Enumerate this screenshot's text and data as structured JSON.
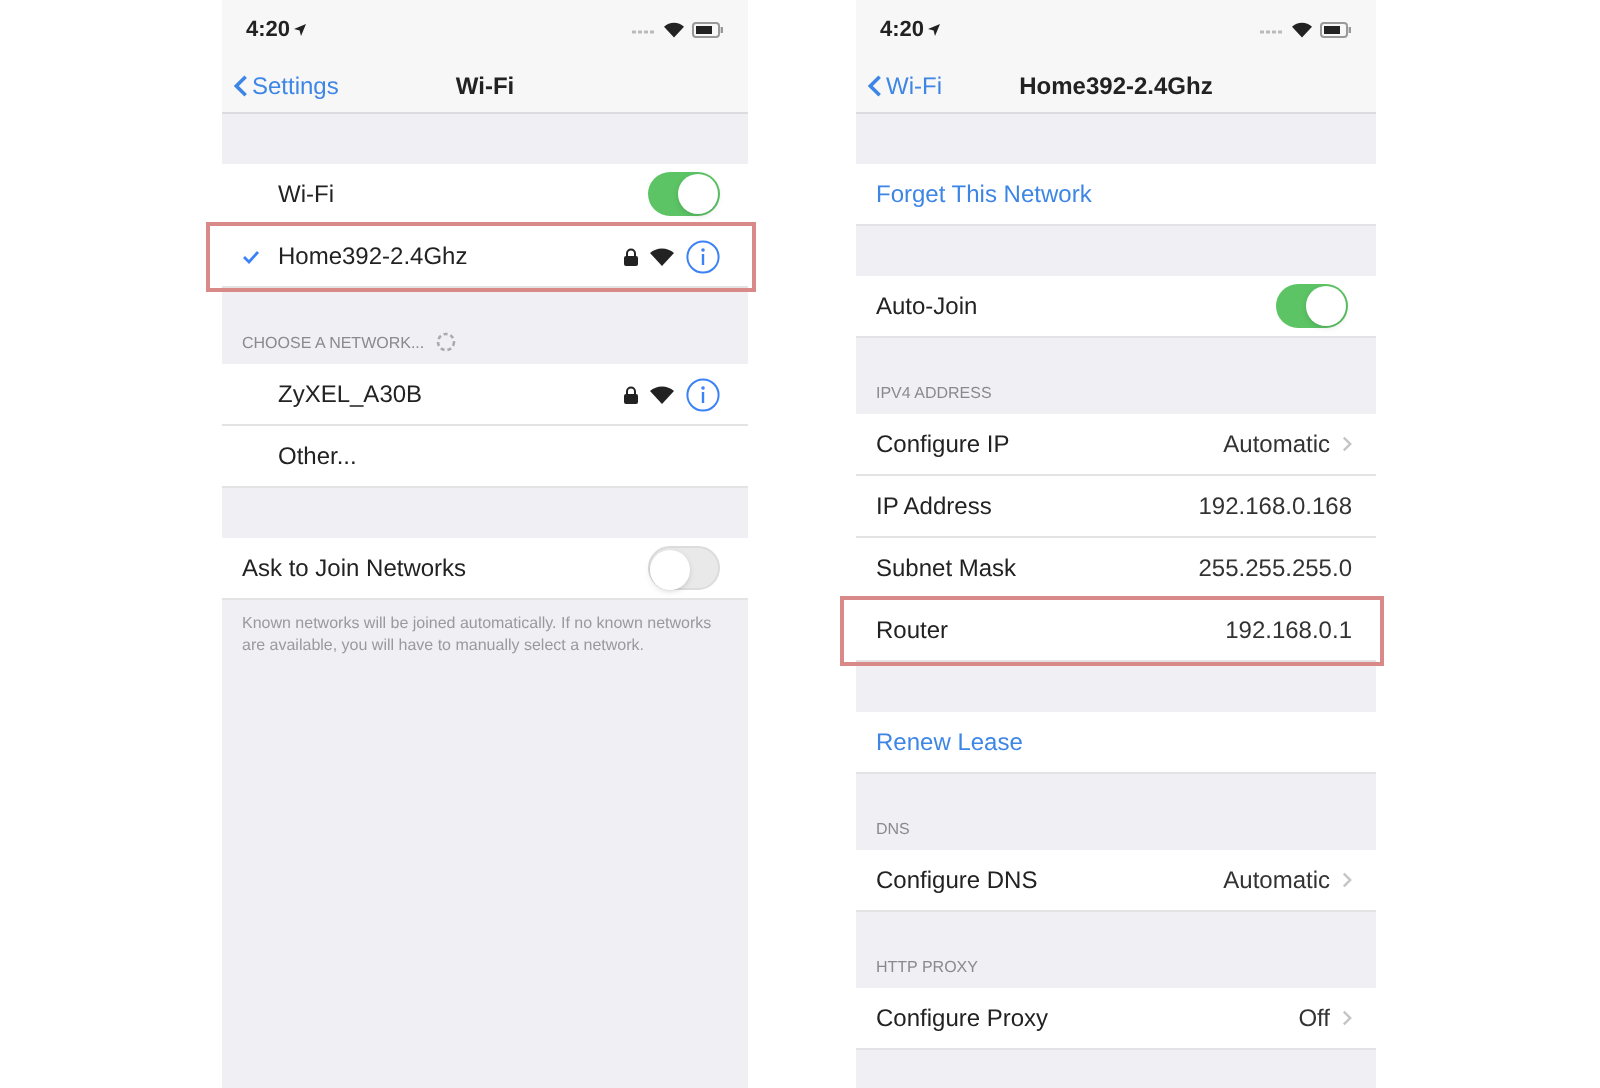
{
  "screens": [
    {
      "status": {
        "time": "4:20"
      },
      "nav": {
        "back": "Settings",
        "title": "Wi-Fi"
      },
      "items": [
        {
          "kind": "gap"
        },
        {
          "kind": "toggle",
          "label": "Wi-Fi",
          "on": true,
          "highlighted": false,
          "indent": true
        },
        {
          "kind": "network",
          "label": "Home392-2.4Ghz",
          "checked": true,
          "highlighted": true
        },
        {
          "kind": "header",
          "label": "CHOOSE A NETWORK...",
          "spinner": true
        },
        {
          "kind": "network",
          "label": "ZyXEL_A30B",
          "checked": false,
          "highlighted": false
        },
        {
          "kind": "other",
          "label": "Other...",
          "highlighted": false
        },
        {
          "kind": "gap"
        },
        {
          "kind": "toggle",
          "label": "Ask to Join Networks",
          "on": false,
          "highlighted": false,
          "indent": false
        },
        {
          "kind": "footer",
          "label": "Known networks will be joined automatically. If no known networks are available, you will have to manually select a network."
        }
      ]
    },
    {
      "status": {
        "time": "4:20"
      },
      "nav": {
        "back": "Wi-Fi",
        "title": "Home392-2.4Ghz"
      },
      "items": [
        {
          "kind": "gap"
        },
        {
          "kind": "link",
          "label": "Forget This Network",
          "highlighted": false
        },
        {
          "kind": "gap"
        },
        {
          "kind": "toggle",
          "label": "Auto-Join",
          "on": true,
          "highlighted": false,
          "indent": false
        },
        {
          "kind": "header",
          "label": "IPV4 ADDRESS",
          "spinner": false
        },
        {
          "kind": "value",
          "label": "Configure IP",
          "value": "Automatic",
          "disclosure": true,
          "highlighted": false
        },
        {
          "kind": "value",
          "label": "IP Address",
          "value": "192.168.0.168",
          "disclosure": false,
          "highlighted": false
        },
        {
          "kind": "value",
          "label": "Subnet Mask",
          "value": "255.255.255.0",
          "disclosure": false,
          "highlighted": false
        },
        {
          "kind": "value",
          "label": "Router",
          "value": "192.168.0.1",
          "disclosure": false,
          "highlighted": true
        },
        {
          "kind": "gap"
        },
        {
          "kind": "link",
          "label": "Renew Lease",
          "highlighted": false
        },
        {
          "kind": "header",
          "label": "DNS",
          "spinner": false
        },
        {
          "kind": "value",
          "label": "Configure DNS",
          "value": "Automatic",
          "disclosure": true,
          "highlighted": false
        },
        {
          "kind": "header",
          "label": "HTTP PROXY",
          "spinner": false
        },
        {
          "kind": "value",
          "label": "Configure Proxy",
          "value": "Off",
          "disclosure": true,
          "highlighted": false
        }
      ]
    }
  ]
}
